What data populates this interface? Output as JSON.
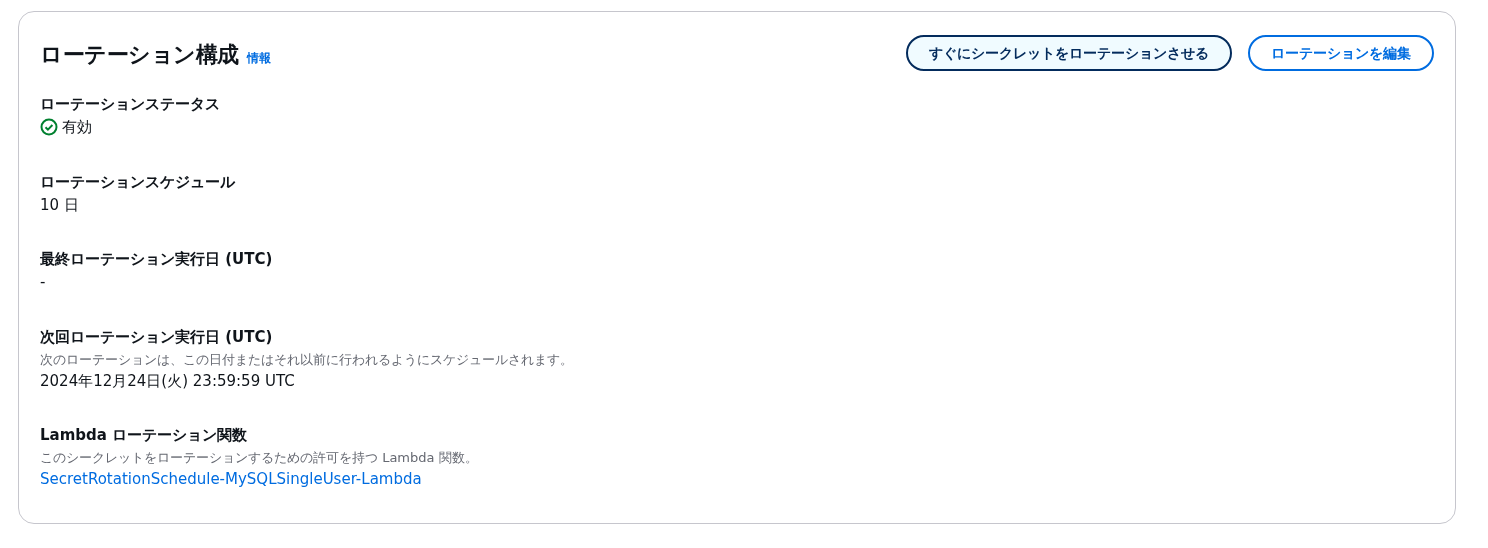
{
  "header": {
    "title": "ローテーション構成",
    "info_link": "情報"
  },
  "buttons": [
    {
      "label": "すぐにシークレットをローテーションさせる",
      "kind": "secondary"
    },
    {
      "label": "ローテーションを編集",
      "kind": "normal"
    }
  ],
  "fields": [
    {
      "label": "ローテーションステータス",
      "kind": "status",
      "value": "有効"
    },
    {
      "label": "ローテーションスケジュール",
      "kind": "text",
      "value": "10 日"
    },
    {
      "label": "最終ローテーション実行日 (UTC)",
      "kind": "text",
      "value": "-"
    },
    {
      "label": "次回ローテーション実行日 (UTC)",
      "kind": "text",
      "description": "次のローテーションは、この日付またはそれ以前に行われるようにスケジュールされます。",
      "value": "2024年12月24日(火) 23:59:59 UTC"
    },
    {
      "label": "Lambda ローテーション関数",
      "kind": "link",
      "description": "このシークレットをローテーションするための許可を持つ Lambda 関数。",
      "value": "SecretRotationSchedule-MySQLSingleUser-Lambda"
    }
  ]
}
